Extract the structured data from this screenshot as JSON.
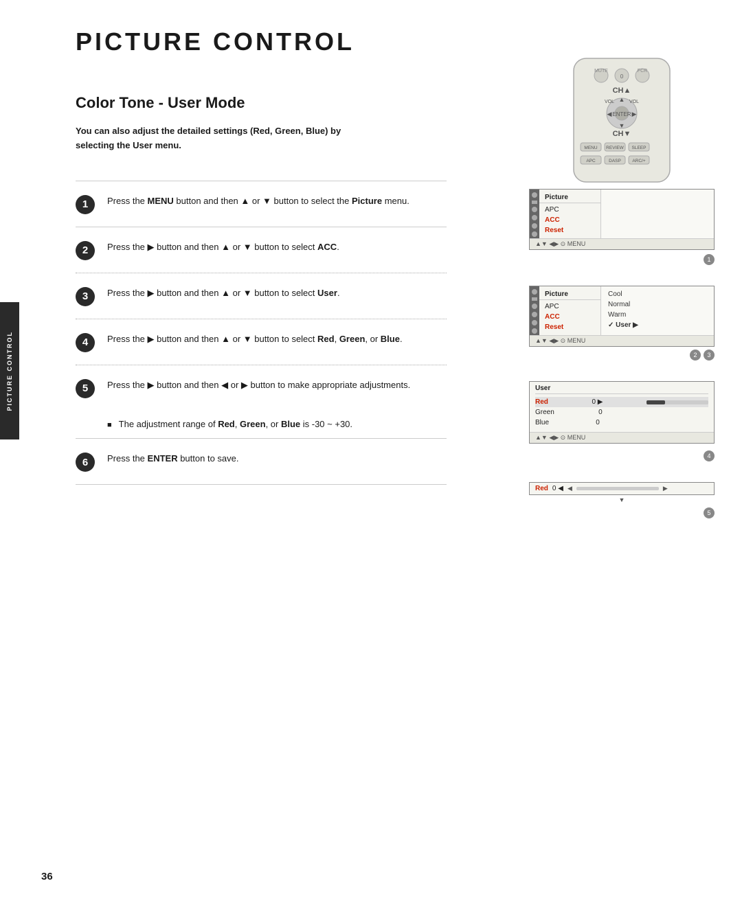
{
  "page": {
    "title": "PICTURE CONTROL",
    "page_number": "36",
    "sidebar_label": "PICTURE CONTROL"
  },
  "section": {
    "title": "Color Tone - User Mode",
    "intro": "You can also adjust the detailed settings (Red, Green, Blue) by selecting the User menu."
  },
  "steps": [
    {
      "number": "1",
      "text_parts": [
        {
          "text": "Press the ",
          "bold": false
        },
        {
          "text": "MENU",
          "bold": true
        },
        {
          "text": " button and then ▲ or ▼ button to select the ",
          "bold": false
        },
        {
          "text": "Picture",
          "bold": true
        },
        {
          "text": " menu.",
          "bold": false
        }
      ]
    },
    {
      "number": "2",
      "text_parts": [
        {
          "text": "Press the ▶ button and then ▲ or ▼ button to select ",
          "bold": false
        },
        {
          "text": "ACC",
          "bold": true
        },
        {
          "text": ".",
          "bold": false
        }
      ]
    },
    {
      "number": "3",
      "text_parts": [
        {
          "text": "Press the ▶ button and then ▲ or ▼ button to select ",
          "bold": false
        },
        {
          "text": "User",
          "bold": true
        },
        {
          "text": ".",
          "bold": false
        }
      ]
    },
    {
      "number": "4",
      "text_parts": [
        {
          "text": "Press the ▶ button and then ▲ or ▼ button to select ",
          "bold": false
        },
        {
          "text": "Red",
          "bold": true
        },
        {
          "text": ", ",
          "bold": false
        },
        {
          "text": "Green",
          "bold": true
        },
        {
          "text": ", or ",
          "bold": false
        },
        {
          "text": "Blue",
          "bold": true
        },
        {
          "text": ".",
          "bold": false
        }
      ]
    },
    {
      "number": "5",
      "text_parts": [
        {
          "text": "Press the ▶ button and then ◀ or ▶ button to make appropriate adjustments.",
          "bold": false
        }
      ],
      "sub_note": "The adjustment range of Red, Green, or Blue is -30 ~ +30."
    },
    {
      "number": "6",
      "text_parts": [
        {
          "text": "Press the ",
          "bold": false
        },
        {
          "text": "ENTER",
          "bold": true
        },
        {
          "text": " button to save.",
          "bold": false
        }
      ]
    }
  ],
  "screens": {
    "screen1": {
      "title": "Picture",
      "menu_items": [
        "APC",
        "ACC",
        "Reset"
      ],
      "footer": "▲▼ ◀▶ ⊙ MENU",
      "badge": "1"
    },
    "screen2": {
      "title": "Picture",
      "menu_items": [
        "APC",
        "ACC",
        "Reset"
      ],
      "right_items": [
        "Cool",
        "Normal",
        "Warm",
        "✓ User"
      ],
      "footer": "▲▼ ◀▶ ⊙ MENU",
      "badge": "2 3"
    },
    "screen3": {
      "title": "User",
      "rows": [
        {
          "label": "Red",
          "value": "0 ▶"
        },
        {
          "label": "Green",
          "value": "0"
        },
        {
          "label": "Blue",
          "value": "0"
        }
      ],
      "footer": "▲▼ ◀▶ ⊙ MENU",
      "badge": "4"
    },
    "screen4": {
      "label": "Red",
      "value": "0 ◀",
      "badge": "5"
    }
  }
}
